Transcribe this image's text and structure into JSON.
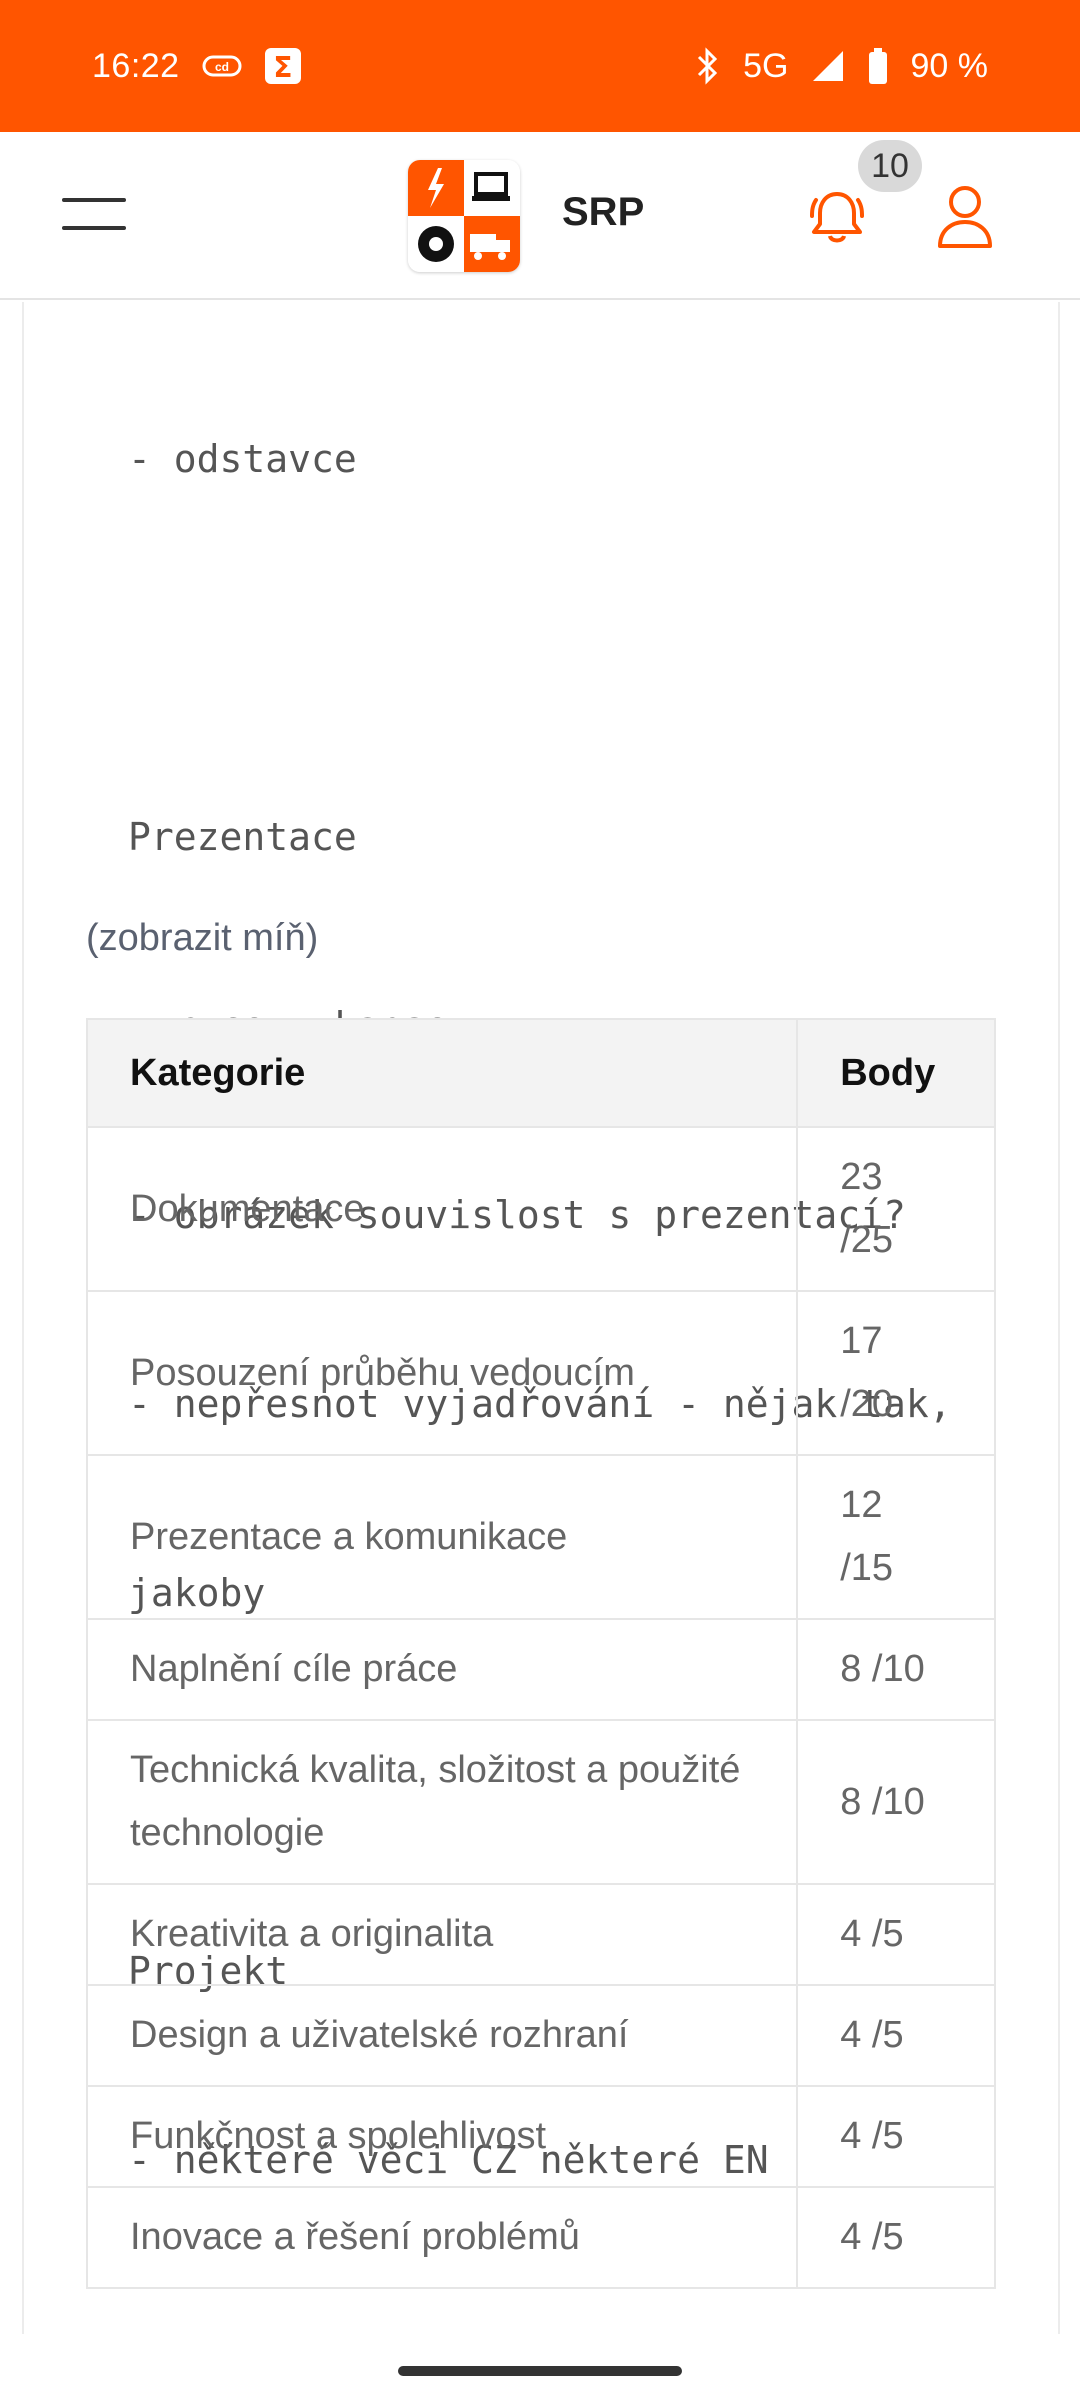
{
  "status_bar": {
    "time": "16:22",
    "network": "5G",
    "battery": "90 %",
    "icons": [
      "cloud-icon",
      "sigma-app-icon",
      "bluetooth-icon",
      "signal-icon",
      "battery-icon"
    ]
  },
  "header": {
    "title": "SRP",
    "notification_count": "10",
    "accent_color": "#ff5500"
  },
  "note": {
    "lines": [
      "- odstavce",
      "",
      "Prezentace",
      "- ruce v kapse",
      "- obrázek souvislost s prezentací?",
      "- nepřesnot vyjadřování - nějak tak,",
      "jakoby",
      "",
      "Projekt",
      "- některé věci CZ některé EN"
    ],
    "toggle_label": "(zobrazit míň)"
  },
  "table": {
    "headers": {
      "category": "Kategorie",
      "points": "Body"
    },
    "rows": [
      {
        "category": "Dokumentace",
        "points_line1": "23",
        "points_line2": "/25"
      },
      {
        "category": "Posouzení průběhu vedoucím",
        "points_line1": "17",
        "points_line2": "/20"
      },
      {
        "category": "Prezentace a komunikace",
        "points_line1": "12",
        "points_line2": "/15"
      },
      {
        "category": "Naplnění cíle práce",
        "points_line1": "8 /10",
        "points_line2": ""
      },
      {
        "category": "Technická kvalita, složitost a použité technologie",
        "points_line1": "8 /10",
        "points_line2": ""
      },
      {
        "category": "Kreativita a originalita",
        "points_line1": "4 /5",
        "points_line2": ""
      },
      {
        "category": "Design a uživatelské rozhraní",
        "points_line1": "4 /5",
        "points_line2": ""
      },
      {
        "category": "Funkčnost a spolehlivost",
        "points_line1": "4 /5",
        "points_line2": ""
      },
      {
        "category": "Inovace a řešení problémů",
        "points_line1": "4 /5",
        "points_line2": ""
      }
    ]
  }
}
